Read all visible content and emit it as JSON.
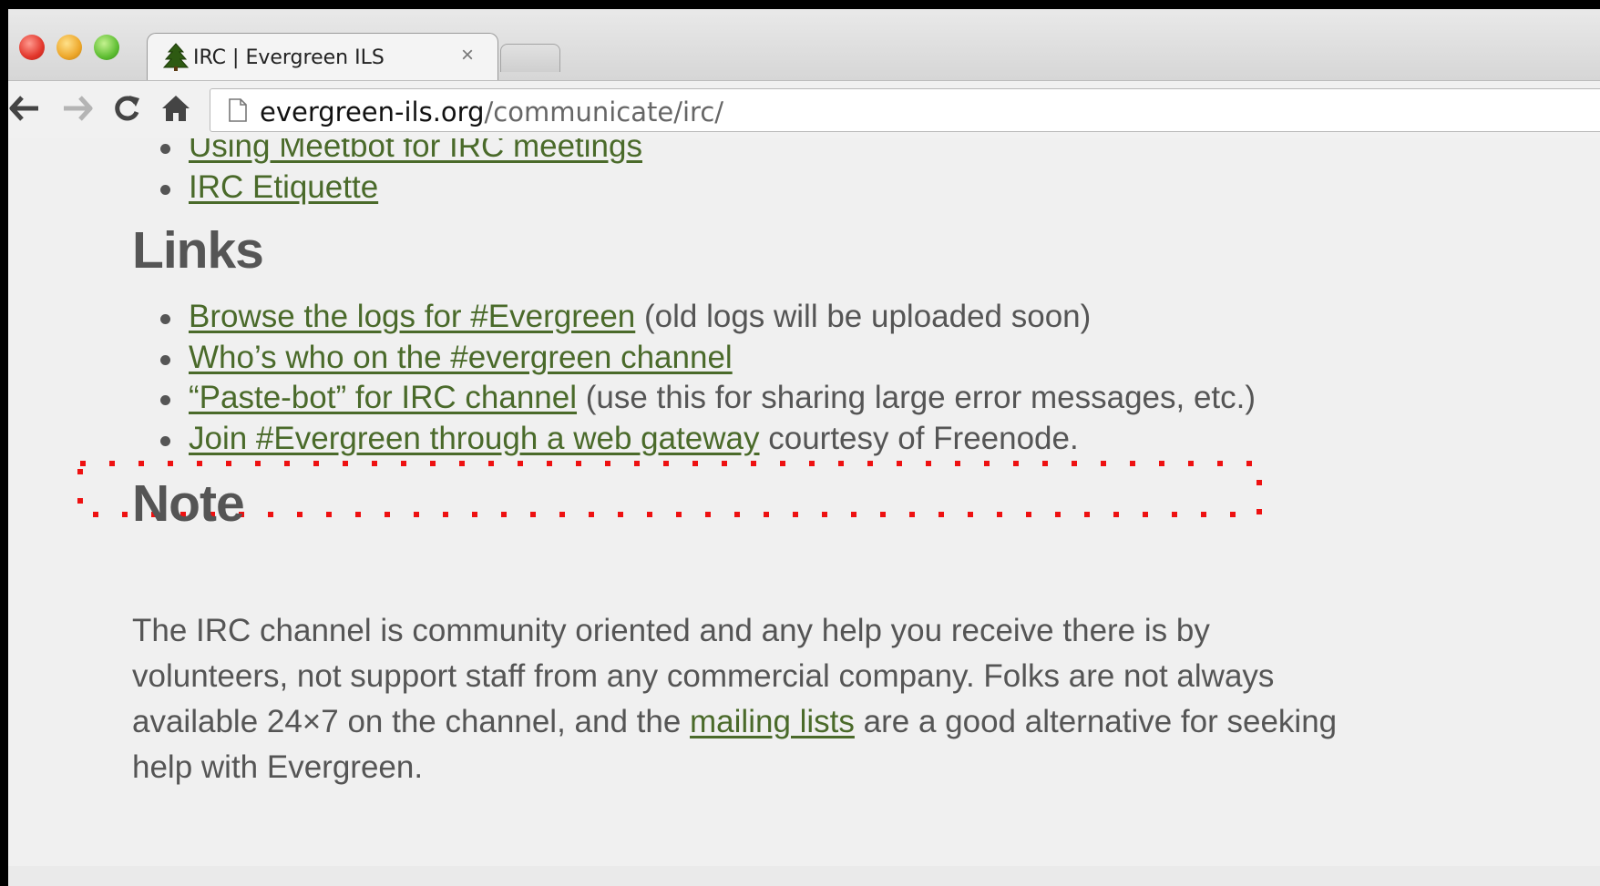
{
  "browser": {
    "tab_title": "IRC | Evergreen ILS",
    "tab_close": "×",
    "url_host": "evergreen-ils.org",
    "url_path": "/communicate/irc/",
    "icons": [
      "back-arrow",
      "forward-arrow",
      "reload",
      "home",
      "page",
      "evergreen-tree-favicon"
    ]
  },
  "content": {
    "top_links": [
      {
        "link": "Using Meetbot for IRC meetings",
        "suffix": ""
      },
      {
        "link": "IRC Etiquette",
        "suffix": ""
      }
    ],
    "links_heading": "Links",
    "links": [
      {
        "link": "Browse the logs for #Evergreen",
        "suffix": " (old logs will be uploaded soon)"
      },
      {
        "link": "Who’s who on the #evergreen channel",
        "suffix": ""
      },
      {
        "link": "“Paste-bot” for IRC channel",
        "suffix": " (use this for sharing large error messages, etc.)"
      },
      {
        "link": "Join #Evergreen through a web gateway",
        "suffix": " courtesy of Freenode."
      }
    ],
    "note_heading": "Note",
    "note_text_1": "The IRC channel is community oriented and any help you receive there is by volunteers, not support staff from any commercial company. Folks are not always available 24×7 on the channel, and the ",
    "note_link": "mailing lists",
    "note_text_2": " are a good alternative for seeking help with Evergreen."
  },
  "colors": {
    "link": "#4a6a2a",
    "text": "#555555",
    "highlight": "#ee1111",
    "page_bg": "#f0f0f0"
  }
}
